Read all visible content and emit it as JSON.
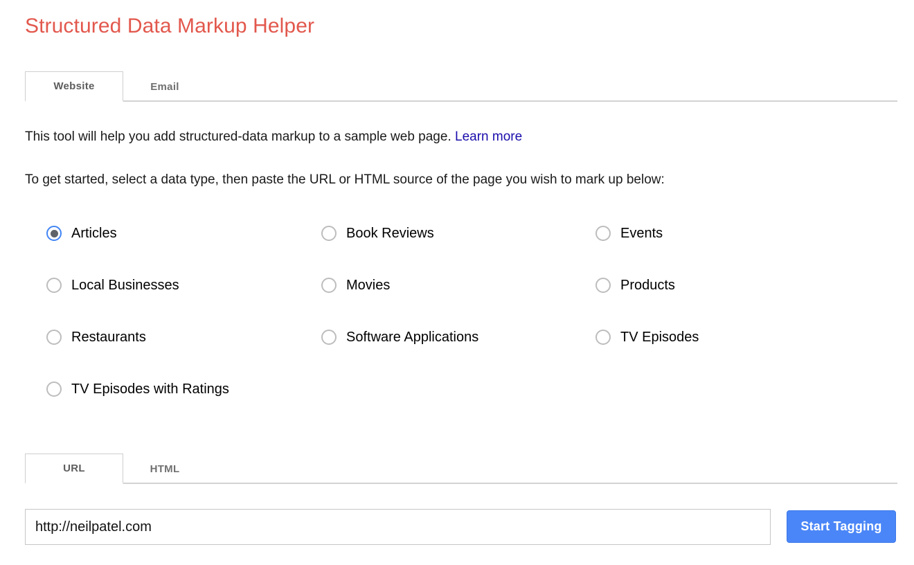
{
  "app": {
    "title": "Structured Data Markup Helper",
    "title_color": "#E2584D"
  },
  "primary_tabs": {
    "items": [
      {
        "id": "website",
        "label": "Website",
        "active": true
      },
      {
        "id": "email",
        "label": "Email",
        "active": false
      }
    ]
  },
  "intro": {
    "line1_text": "This tool will help you add structured-data markup to a sample web page.",
    "line1_link": "Learn more",
    "line1_link_color": "#1a0dab",
    "line2": "To get started, select a data type, then paste the URL or HTML source of the page you wish to mark up below:"
  },
  "data_types": {
    "selected": "Articles",
    "selected_color": "#4285f4",
    "rows": [
      [
        {
          "label": "Articles",
          "checked": true
        },
        {
          "label": "Book Reviews",
          "checked": false
        },
        {
          "label": "Events",
          "checked": false
        }
      ],
      [
        {
          "label": "Local Businesses",
          "checked": false
        },
        {
          "label": "Movies",
          "checked": false
        },
        {
          "label": "Products",
          "checked": false
        }
      ],
      [
        {
          "label": "Restaurants",
          "checked": false
        },
        {
          "label": "Software Applications",
          "checked": false
        },
        {
          "label": "TV Episodes",
          "checked": false
        }
      ],
      [
        {
          "label": "TV Episodes with Ratings",
          "checked": false
        }
      ]
    ]
  },
  "source_tabs": {
    "items": [
      {
        "id": "url",
        "label": "URL",
        "active": true
      },
      {
        "id": "html",
        "label": "HTML",
        "active": false
      }
    ]
  },
  "entry": {
    "url_value": "http://neilpatel.com",
    "url_placeholder": "",
    "submit_label": "Start Tagging",
    "submit_color": "#4a86f7"
  }
}
